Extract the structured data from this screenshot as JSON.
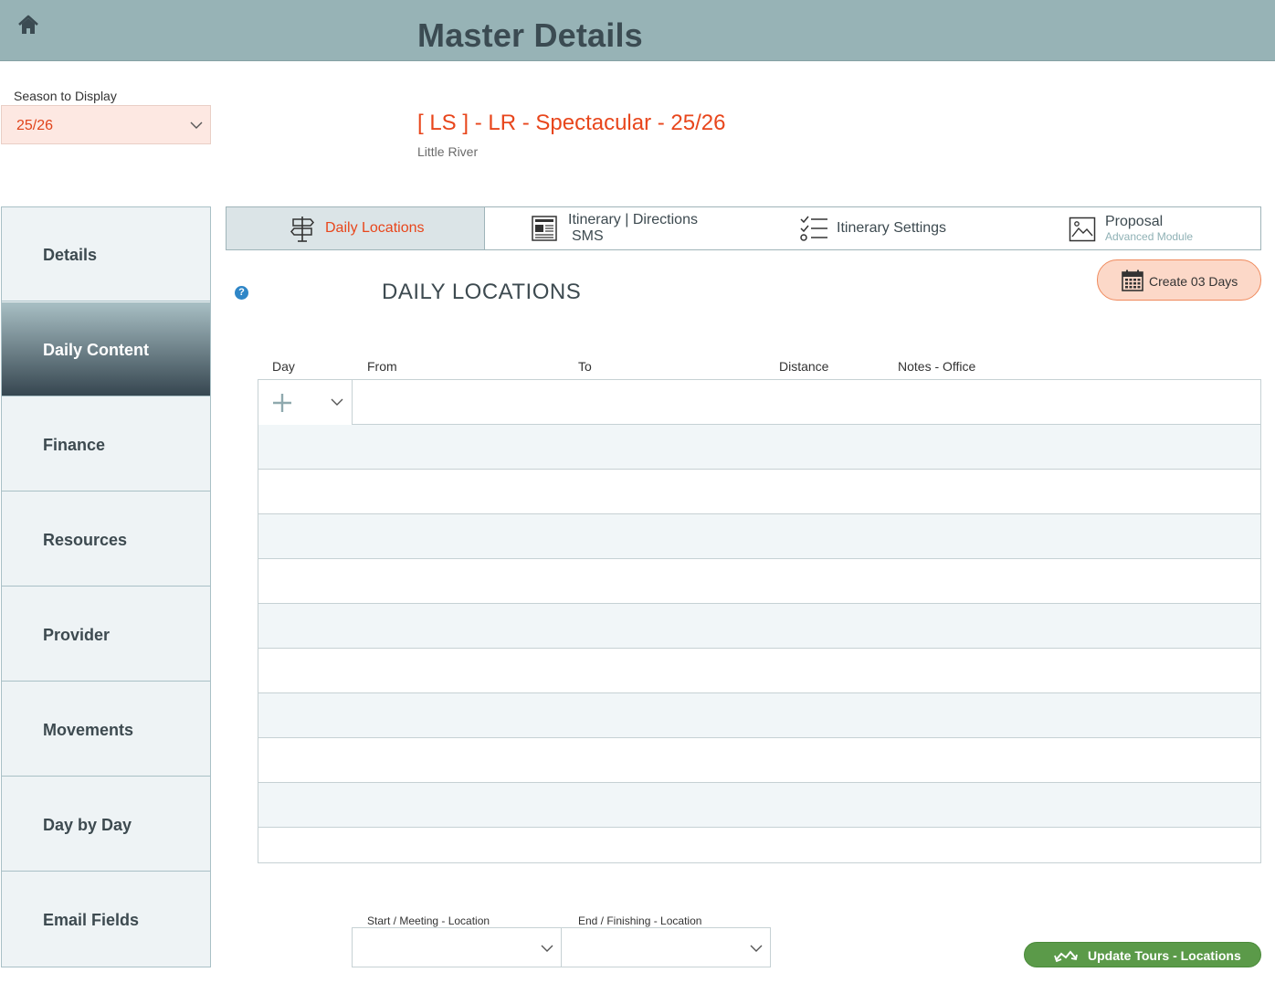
{
  "header": {
    "title": "Master Details",
    "home_icon": "home-icon"
  },
  "season": {
    "label": "Season to Display",
    "value": "25/26"
  },
  "tour": {
    "title": "[ LS ] - LR - Spectacular - 25/26",
    "subtitle": "Little River"
  },
  "sidebar": {
    "items": [
      {
        "label": "Details",
        "active": false
      },
      {
        "label": "Daily Content",
        "active": true
      },
      {
        "label": "Finance",
        "active": false
      },
      {
        "label": "Resources",
        "active": false
      },
      {
        "label": "Provider",
        "active": false
      },
      {
        "label": "Movements",
        "active": false
      },
      {
        "label": "Day by Day",
        "active": false
      },
      {
        "label": "Email Fields",
        "active": false
      }
    ]
  },
  "tabs": [
    {
      "label": "Daily Locations",
      "icon": "signpost-icon",
      "active": true
    },
    {
      "label": "Itinerary | Directions",
      "label2": "SMS",
      "icon": "newspaper-icon",
      "active": false
    },
    {
      "label": "Itinerary Settings",
      "icon": "checklist-icon",
      "active": false
    },
    {
      "label": "Proposal",
      "sublabel": "Advanced Module",
      "icon": "image-icon",
      "active": false
    }
  ],
  "section": {
    "title": "DAILY  LOCATIONS",
    "help_icon": "?"
  },
  "create_button": {
    "label": "Create 03 Days",
    "icon": "calendar-icon"
  },
  "table": {
    "columns": [
      "Day",
      "From",
      "To",
      "Distance",
      "Notes - Office"
    ],
    "row_count": 11
  },
  "bottom": {
    "start_label": "Start / Meeting - Location",
    "end_label": "End / Finishing - Location",
    "start_value": "",
    "end_value": ""
  },
  "update_button": {
    "label": "Update Tours - Locations",
    "icon": "route-icon"
  },
  "colors": {
    "header_bg": "#97b3b6",
    "accent": "#e8461c",
    "active_tab_bg": "#dbe4e7",
    "create_bg": "#fcd8c8",
    "update_bg": "#5b9a49"
  }
}
